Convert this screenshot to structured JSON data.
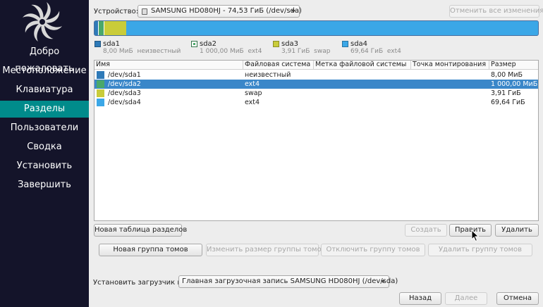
{
  "sidebar": {
    "items": [
      {
        "label": "Добро пожаловать",
        "active": false
      },
      {
        "label": "Местоположение",
        "active": false
      },
      {
        "label": "Клавиатура",
        "active": false
      },
      {
        "label": "Разделы",
        "active": true
      },
      {
        "label": "Пользователи",
        "active": false
      },
      {
        "label": "Сводка",
        "active": false
      },
      {
        "label": "Установить",
        "active": false
      },
      {
        "label": "Завершить",
        "active": false
      }
    ],
    "active_color": "#008b8b",
    "bg_color": "#14142a"
  },
  "device": {
    "label": "Устройство:",
    "value": "SAMSUNG HD080HJ - 74,53 ГиБ (/dev/sda)",
    "revert_label": "Отменить все изменения"
  },
  "partitions": [
    {
      "name": "sda1",
      "path": "/dev/sda1",
      "fs": "неизвестный",
      "size": "8,00 МиБ",
      "color": "#2e7ab8",
      "fraction": 0.0001,
      "selected": false
    },
    {
      "name": "sda2",
      "path": "/dev/sda2",
      "fs": "ext4",
      "size": "1 000,00 МиБ",
      "color": "#4aa86a",
      "fraction": 0.013,
      "selected": true
    },
    {
      "name": "sda3",
      "path": "/dev/sda3",
      "fs": "swap",
      "size": "3,91 ГиБ",
      "color": "#c9cc3a",
      "fraction": 0.052,
      "selected": false
    },
    {
      "name": "sda4",
      "path": "/dev/sda4",
      "fs": "ext4",
      "size": "69,64 ГиБ",
      "color": "#3ba7e7",
      "fraction": 0.934,
      "selected": false
    }
  ],
  "legend": [
    {
      "name": "sda1",
      "size": "8,00 МиБ",
      "fs": "неизвестный"
    },
    {
      "name": "sda2",
      "size": "1 000,00 МиБ",
      "fs": "ext4"
    },
    {
      "name": "sda3",
      "size": "3,91 ГиБ",
      "fs": "swap"
    },
    {
      "name": "sda4",
      "size": "69,64 ГиБ",
      "fs": "ext4"
    }
  ],
  "table": {
    "columns": [
      "Имя",
      "Файловая система",
      "Метка файловой системы",
      "Точка монтирования",
      "Размер"
    ]
  },
  "buttons": {
    "new_table": "Новая таблица разделов",
    "create": "Создать",
    "edit": "Править",
    "delete": "Удалить",
    "new_group": "Новая группа томов",
    "resize_group": "Изменить размер группы томов",
    "deactivate_group": "Отключить группу томов",
    "delete_group": "Удалить группу томов"
  },
  "bootloader": {
    "label": "Установить загрузчик в:",
    "value": "Главная загрузочная запись SAMSUNG HD080HJ (/dev/sda)"
  },
  "footer": {
    "back": "Назад",
    "next": "Далее",
    "cancel": "Отмена"
  }
}
